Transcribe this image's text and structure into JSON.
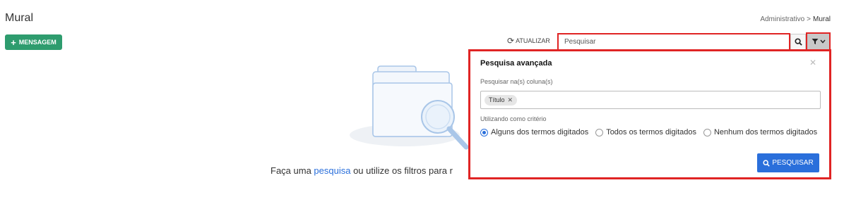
{
  "header": {
    "title": "Mural",
    "breadcrumb": [
      "Administrativo",
      ">",
      "Mural"
    ]
  },
  "toolbar": {
    "new_message_label": "MENSAGEM",
    "refresh_label": "ATUALIZAR",
    "search_placeholder": "Pesquisar"
  },
  "empty_state": {
    "text_before": "Faça uma ",
    "link_text": "pesquisa",
    "text_after": " ou utilize os filtros para r"
  },
  "advanced_search": {
    "title": "Pesquisa avançada",
    "columns_label": "Pesquisar na(s) coluna(s)",
    "selected_columns": [
      "Título"
    ],
    "criteria_label": "Utilizando como critério",
    "criteria_options": [
      {
        "label": "Alguns dos termos digitados",
        "checked": true
      },
      {
        "label": "Todos os termos digitados",
        "checked": false
      },
      {
        "label": "Nenhum dos termos digitados",
        "checked": false
      }
    ],
    "submit_label": "PESQUISAR"
  },
  "colors": {
    "primary": "#2a6fdb",
    "success": "#2e9c6e",
    "highlight": "#e02424"
  },
  "icons": {
    "plus": "plus-icon",
    "refresh": "refresh-icon",
    "search": "search-icon",
    "filter": "filter-icon",
    "close": "close-icon"
  }
}
